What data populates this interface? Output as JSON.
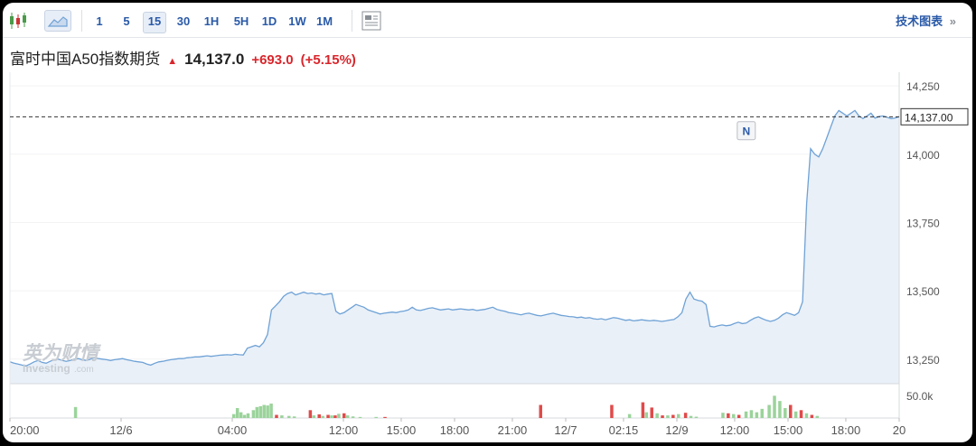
{
  "toolbar": {
    "intervals": [
      "1",
      "5",
      "15",
      "30",
      "1H",
      "5H",
      "1D",
      "1W",
      "1M"
    ],
    "active_interval": "15",
    "tech_chart_label": "技术图表",
    "tech_chart_arrow": "»"
  },
  "instrument": {
    "name": "富时中国A50指数期货",
    "price": "14,137.0",
    "change": "+693.0",
    "change_pct": "(+5.15%)"
  },
  "watermark": {
    "cn": "英为财情",
    "en": "Investing",
    "domain": ".com"
  },
  "news_marker": "N",
  "colors": {
    "line": "#6fa2d6",
    "area": "#e9f0f8",
    "up_volume": "#9bd39b",
    "down_volume": "#e04a4a",
    "accent": "#2a5aa8",
    "change": "#d9262c"
  },
  "chart_data": {
    "type": "area",
    "ylim": [
      13160,
      14300
    ],
    "yticks": [
      13250,
      13500,
      13750,
      14000,
      14250
    ],
    "ytick_labels": [
      "13,250",
      "13,500",
      "13,750",
      "14,000",
      "14,250"
    ],
    "last_price_label": "14,137.00",
    "last_price": 14137,
    "x_labels": [
      "20:00",
      "12/6",
      "04:00",
      "12:00",
      "15:00",
      "18:00",
      "21:00",
      "12/7",
      "02:15",
      "12/9",
      "12:00",
      "15:00",
      "18:00",
      "20"
    ],
    "x_label_index": [
      0,
      25,
      50,
      75,
      88,
      100,
      113,
      125,
      138,
      150,
      163,
      175,
      188,
      200
    ],
    "price": [
      13240,
      13235,
      13232,
      13228,
      13225,
      13232,
      13240,
      13245,
      13238,
      13235,
      13242,
      13248,
      13250,
      13245,
      13242,
      13245,
      13250,
      13252,
      13248,
      13245,
      13250,
      13255,
      13252,
      13250,
      13248,
      13245,
      13248,
      13250,
      13252,
      13248,
      13245,
      13242,
      13240,
      13238,
      13232,
      13228,
      13235,
      13240,
      13242,
      13245,
      13248,
      13250,
      13252,
      13252,
      13255,
      13256,
      13258,
      13258,
      13260,
      13262,
      13260,
      13262,
      13264,
      13265,
      13266,
      13265,
      13268,
      13266,
      13265,
      13290,
      13295,
      13300,
      13295,
      13310,
      13340,
      13430,
      13445,
      13460,
      13480,
      13490,
      13495,
      13485,
      13490,
      13495,
      13490,
      13492,
      13488,
      13490,
      13485,
      13488,
      13490,
      13425,
      13415,
      13420,
      13430,
      13440,
      13450,
      13445,
      13440,
      13430,
      13425,
      13420,
      13415,
      13418,
      13420,
      13422,
      13420,
      13424,
      13426,
      13430,
      13440,
      13430,
      13428,
      13432,
      13436,
      13438,
      13434,
      13430,
      13432,
      13434,
      13430,
      13432,
      13434,
      13432,
      13430,
      13432,
      13428,
      13430,
      13432,
      13436,
      13440,
      13432,
      13428,
      13425,
      13420,
      13418,
      13415,
      13412,
      13416,
      13418,
      13414,
      13410,
      13408,
      13412,
      13415,
      13418,
      13414,
      13410,
      13408,
      13406,
      13405,
      13402,
      13404,
      13400,
      13402,
      13398,
      13396,
      13398,
      13394,
      13398,
      13402,
      13400,
      13396,
      13392,
      13394,
      13390,
      13392,
      13394,
      13392,
      13390,
      13392,
      13390,
      13388,
      13390,
      13393,
      13395,
      13405,
      13420,
      13470,
      13495,
      13470,
      13465,
      13462,
      13450,
      13370,
      13368,
      13372,
      13375,
      13372,
      13374,
      13380,
      13385,
      13380,
      13382,
      13392,
      13400,
      13405,
      13398,
      13392,
      13388,
      13392,
      13400,
      13412,
      13420,
      13415,
      13410,
      13420,
      13460,
      13820,
      14020,
      14000,
      13990,
      14020,
      14060,
      14100,
      14140,
      14160,
      14150,
      14140,
      14150,
      14160,
      14140,
      14130,
      14140,
      14150,
      14132,
      14138,
      14140,
      14135,
      14130,
      14132,
      14137
    ],
    "volume": [
      0,
      0,
      0,
      0,
      0,
      0,
      0,
      0,
      0,
      0,
      0,
      0,
      0,
      0,
      0,
      0,
      0,
      0,
      0,
      0,
      0,
      0,
      0,
      0,
      0,
      0,
      0,
      0,
      0,
      0,
      0,
      0,
      0,
      0,
      0,
      0,
      0,
      0,
      0,
      0,
      0,
      0,
      0,
      0,
      0,
      0,
      0,
      0,
      0,
      0,
      0,
      0,
      0,
      0,
      0,
      0,
      0,
      0,
      0,
      0,
      0,
      0,
      0,
      0,
      0,
      0,
      0,
      0,
      0,
      0,
      0,
      0,
      0,
      0,
      0,
      0,
      0,
      0,
      0,
      0,
      0,
      0,
      0,
      0,
      0,
      0,
      0,
      0,
      0,
      0,
      0,
      0,
      0,
      0,
      0,
      0,
      0,
      0,
      0,
      0,
      0,
      0,
      0,
      0,
      0,
      0,
      0,
      0,
      0,
      0,
      0,
      0,
      0,
      0,
      0,
      0,
      0,
      0,
      0,
      0,
      0,
      0,
      0,
      0,
      0,
      0,
      0,
      0,
      0,
      0,
      0,
      0,
      0,
      0,
      0,
      0,
      0,
      0,
      0,
      0,
      0,
      0,
      0,
      0,
      0,
      0,
      0,
      0,
      0,
      0,
      0,
      0,
      0,
      0,
      0,
      0,
      0,
      0,
      0,
      0,
      0,
      0,
      0,
      0,
      0,
      0,
      0,
      0,
      0,
      0,
      0,
      0,
      0,
      0,
      0,
      0,
      0,
      0,
      0,
      0,
      0,
      0,
      0,
      0,
      0,
      0,
      0,
      0,
      0,
      0,
      0,
      0,
      0,
      0,
      0,
      0,
      0,
      0,
      0,
      0
    ],
    "volume_bars": [
      {
        "x": 0.072,
        "v": 0.42,
        "up": true
      },
      {
        "x": 0.25,
        "v": 0.15,
        "up": true
      },
      {
        "x": 0.254,
        "v": 0.38,
        "up": true
      },
      {
        "x": 0.258,
        "v": 0.22,
        "up": true
      },
      {
        "x": 0.262,
        "v": 0.12,
        "up": true
      },
      {
        "x": 0.266,
        "v": 0.18,
        "up": true
      },
      {
        "x": 0.272,
        "v": 0.3,
        "up": true
      },
      {
        "x": 0.276,
        "v": 0.42,
        "up": true
      },
      {
        "x": 0.28,
        "v": 0.45,
        "up": true
      },
      {
        "x": 0.284,
        "v": 0.5,
        "up": true
      },
      {
        "x": 0.288,
        "v": 0.48,
        "up": true
      },
      {
        "x": 0.292,
        "v": 0.55,
        "up": true
      },
      {
        "x": 0.298,
        "v": 0.12,
        "up": false
      },
      {
        "x": 0.304,
        "v": 0.1,
        "up": true
      },
      {
        "x": 0.312,
        "v": 0.08,
        "up": true
      },
      {
        "x": 0.318,
        "v": 0.06,
        "up": true
      },
      {
        "x": 0.336,
        "v": 0.3,
        "up": false
      },
      {
        "x": 0.34,
        "v": 0.1,
        "up": true
      },
      {
        "x": 0.346,
        "v": 0.14,
        "up": false
      },
      {
        "x": 0.35,
        "v": 0.08,
        "up": true
      },
      {
        "x": 0.356,
        "v": 0.12,
        "up": false
      },
      {
        "x": 0.36,
        "v": 0.1,
        "up": true
      },
      {
        "x": 0.364,
        "v": 0.1,
        "up": false
      },
      {
        "x": 0.368,
        "v": 0.16,
        "up": true
      },
      {
        "x": 0.374,
        "v": 0.18,
        "up": false
      },
      {
        "x": 0.378,
        "v": 0.1,
        "up": true
      },
      {
        "x": 0.384,
        "v": 0.06,
        "up": true
      },
      {
        "x": 0.392,
        "v": 0.04,
        "up": true
      },
      {
        "x": 0.41,
        "v": 0.04,
        "up": true
      },
      {
        "x": 0.42,
        "v": 0.04,
        "up": false
      },
      {
        "x": 0.595,
        "v": 0.5,
        "up": false
      },
      {
        "x": 0.675,
        "v": 0.5,
        "up": false
      },
      {
        "x": 0.695,
        "v": 0.15,
        "up": true
      },
      {
        "x": 0.71,
        "v": 0.6,
        "up": false
      },
      {
        "x": 0.714,
        "v": 0.22,
        "up": true
      },
      {
        "x": 0.72,
        "v": 0.4,
        "up": false
      },
      {
        "x": 0.726,
        "v": 0.18,
        "up": true
      },
      {
        "x": 0.732,
        "v": 0.1,
        "up": false
      },
      {
        "x": 0.738,
        "v": 0.1,
        "up": true
      },
      {
        "x": 0.744,
        "v": 0.12,
        "up": false
      },
      {
        "x": 0.75,
        "v": 0.15,
        "up": true
      },
      {
        "x": 0.758,
        "v": 0.2,
        "up": false
      },
      {
        "x": 0.764,
        "v": 0.08,
        "up": true
      },
      {
        "x": 0.77,
        "v": 0.05,
        "up": true
      },
      {
        "x": 0.8,
        "v": 0.2,
        "up": true
      },
      {
        "x": 0.806,
        "v": 0.18,
        "up": false
      },
      {
        "x": 0.812,
        "v": 0.15,
        "up": true
      },
      {
        "x": 0.818,
        "v": 0.12,
        "up": false
      },
      {
        "x": 0.826,
        "v": 0.25,
        "up": true
      },
      {
        "x": 0.832,
        "v": 0.3,
        "up": true
      },
      {
        "x": 0.838,
        "v": 0.22,
        "up": true
      },
      {
        "x": 0.844,
        "v": 0.35,
        "up": true
      },
      {
        "x": 0.852,
        "v": 0.5,
        "up": true
      },
      {
        "x": 0.858,
        "v": 0.85,
        "up": true
      },
      {
        "x": 0.864,
        "v": 0.65,
        "up": true
      },
      {
        "x": 0.87,
        "v": 0.38,
        "up": true
      },
      {
        "x": 0.876,
        "v": 0.5,
        "up": false
      },
      {
        "x": 0.882,
        "v": 0.25,
        "up": true
      },
      {
        "x": 0.888,
        "v": 0.3,
        "up": false
      },
      {
        "x": 0.894,
        "v": 0.18,
        "up": true
      },
      {
        "x": 0.9,
        "v": 0.12,
        "up": false
      },
      {
        "x": 0.906,
        "v": 0.08,
        "up": true
      }
    ],
    "volume_label": "50.0k"
  }
}
